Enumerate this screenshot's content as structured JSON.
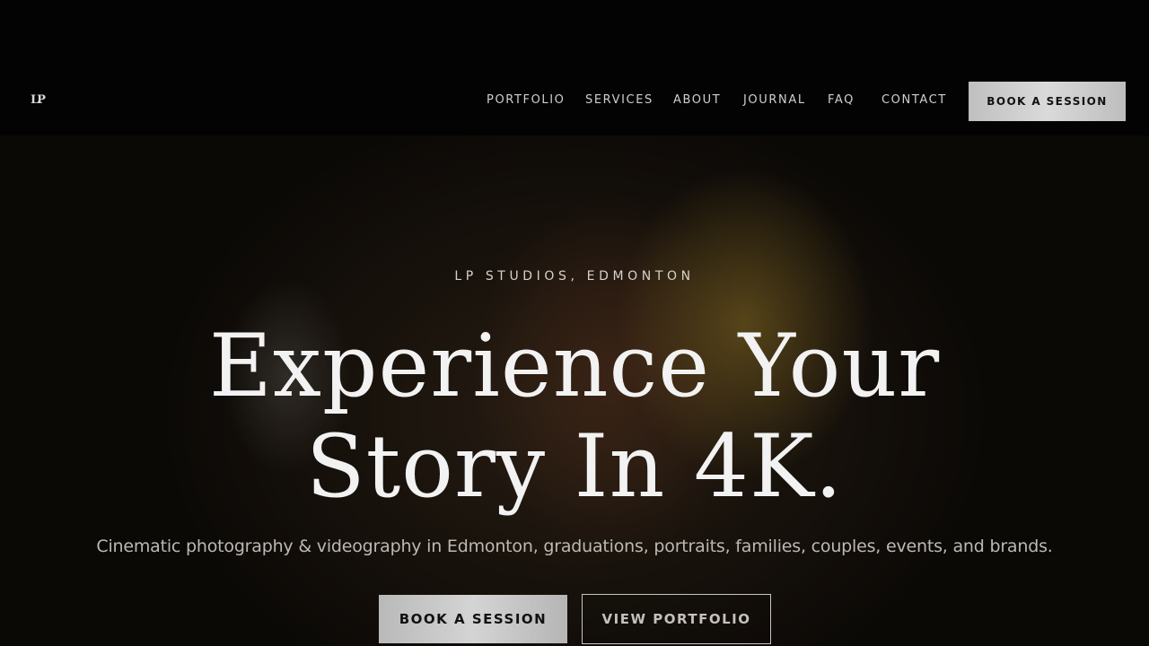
{
  "brand": {
    "logo_text": "LP"
  },
  "nav": {
    "items": [
      {
        "label": "PORTFOLIO"
      },
      {
        "label": "SERVICES"
      },
      {
        "label": "ABOUT"
      },
      {
        "label": "JOURNAL"
      },
      {
        "label": "FAQ"
      },
      {
        "label": "CONTACT"
      }
    ],
    "cta_label": "BOOK A SESSION"
  },
  "hero": {
    "eyebrow": "LP STUDIOS, EDMONTON",
    "headline_line1": "Experience Your",
    "headline_line2": "Story In 4K.",
    "subtitle": "Cinematic photography & videography in Edmonton, graduations, portraits, families, couples, events, and brands.",
    "primary_cta": "BOOK A SESSION",
    "secondary_cta": "VIEW PORTFOLIO"
  }
}
